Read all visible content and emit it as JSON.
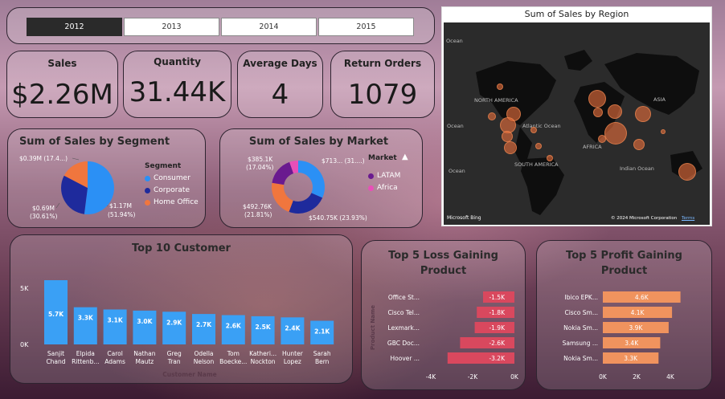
{
  "years": {
    "items": [
      "2012",
      "2013",
      "2014",
      "2015"
    ],
    "selected": "2012"
  },
  "kpis": [
    {
      "label": "Sales",
      "value": "$2.26M"
    },
    {
      "label": "Quantity",
      "value": "31.44K"
    },
    {
      "label": "Average Days",
      "value": "4"
    },
    {
      "label": "Return Orders",
      "value": "1079"
    }
  ],
  "segment": {
    "title": "Sum of Sales by Segment",
    "legend_title": "Segment",
    "labels": {
      "consumer": "$1.17M",
      "consumer_pct": "(51.94%)",
      "corporate": "$0.69M",
      "corporate_pct": "(30.61%)",
      "home": "$0.39M (17.4...)"
    },
    "colors": {
      "Consumer": "#2b90f5",
      "Corporate": "#1e2a9c",
      "Home Office": "#f0763e"
    }
  },
  "market": {
    "title": "Sum of Sales by Market",
    "legend_title": "Market",
    "legend_items": [
      "LATAM",
      "Africa"
    ],
    "labels": {
      "a": "$713... (31....)",
      "b": "$540.75K (23.93%)",
      "c": "$492.76K",
      "c_pct": "(21.81%)",
      "d": "$385.1K",
      "d_pct": "(17.04%)"
    },
    "colors": {
      "blue": "#2b90f5",
      "navy": "#1e2a9c",
      "orange": "#f0763e",
      "purple": "#6a1a8f",
      "pink": "#e84fb8"
    }
  },
  "map": {
    "title": "Sum of Sales by Region",
    "labels": {
      "na": "NORTH AMERICA",
      "sa": "SOUTH AMERICA",
      "africa": "AFRICA",
      "asia": "ASIA",
      "atlantic": "Atlantic Ocean",
      "indian": "Indian Ocean",
      "ocean1": "Ocean",
      "ocean2": "Ocean",
      "ocean3": "Ocean"
    },
    "bing": "Microsoft Bing",
    "copyright": "© 2024 Microsoft Corporation",
    "terms": "Terms"
  },
  "chart_data": [
    {
      "type": "pie",
      "title": "Sum of Sales by Segment",
      "categories": [
        "Consumer",
        "Corporate",
        "Home Office"
      ],
      "values": [
        1.17,
        0.69,
        0.39
      ],
      "percent": [
        51.94,
        30.61,
        17.4
      ],
      "unit": "$M"
    },
    {
      "type": "pie",
      "donut": true,
      "title": "Sum of Sales by Market",
      "categories": [
        "",
        "",
        "",
        "",
        ""
      ],
      "values": [
        713,
        540.75,
        492.76,
        385.1,
        120
      ],
      "percent": [
        31.0,
        23.93,
        21.81,
        17.04,
        6.22
      ],
      "unit": "$K"
    },
    {
      "type": "bar",
      "title": "Top 10 Customer",
      "categories": [
        "Sanjit Chand",
        "Elpida Rittenb...",
        "Carol Adams",
        "Nathan Mautz",
        "Greg Tran",
        "Odella Nelson",
        "Tom Boecke...",
        "Katheri... Nockton",
        "Hunter Lopez",
        "Sarah Bern"
      ],
      "values": [
        5.7,
        3.3,
        3.1,
        3.0,
        2.9,
        2.7,
        2.6,
        2.5,
        2.4,
        2.1
      ],
      "data_labels": [
        "5.7K",
        "3.3K",
        "3.1K",
        "3.0K",
        "2.9K",
        "2.7K",
        "2.6K",
        "2.5K",
        "2.4K",
        "2.1K"
      ],
      "yticks": [
        "0K",
        "5K"
      ],
      "xlabel": "Customer Name",
      "ylim": [
        0,
        6.2
      ],
      "color": "#3aa0f5"
    },
    {
      "type": "bar",
      "orientation": "horizontal",
      "title": "Top 5 Loss Gaining Product",
      "categories": [
        "Office St...",
        "Cisco Tel...",
        "Lexmark...",
        "GBC Doc...",
        "Hoover ..."
      ],
      "values": [
        -1.5,
        -1.8,
        -1.9,
        -2.6,
        -3.2
      ],
      "data_labels": [
        "-1.5K",
        "-1.8K",
        "-1.9K",
        "-2.6K",
        "-3.2K"
      ],
      "xticks": [
        "-4K",
        "-2K",
        "0K"
      ],
      "ylabel": "Product Name",
      "xlim": [
        -4,
        0
      ],
      "color": "#d9485e"
    },
    {
      "type": "bar",
      "orientation": "horizontal",
      "title": "Top 5 Profit Gaining Product",
      "categories": [
        "Ibico EPK...",
        "Cisco Sm...",
        "Nokia Sm...",
        "Samsung ...",
        "Nokia Sm..."
      ],
      "values": [
        4.6,
        4.1,
        3.9,
        3.4,
        3.3
      ],
      "data_labels": [
        "4.6K",
        "4.1K",
        "3.9K",
        "3.4K",
        "3.3K"
      ],
      "xticks": [
        "0K",
        "2K",
        "4K"
      ],
      "xlim": [
        0,
        4.6
      ],
      "color": "#f0935e"
    },
    {
      "type": "scatter",
      "subtype": "bubble-map",
      "title": "Sum of Sales by Region"
    }
  ]
}
